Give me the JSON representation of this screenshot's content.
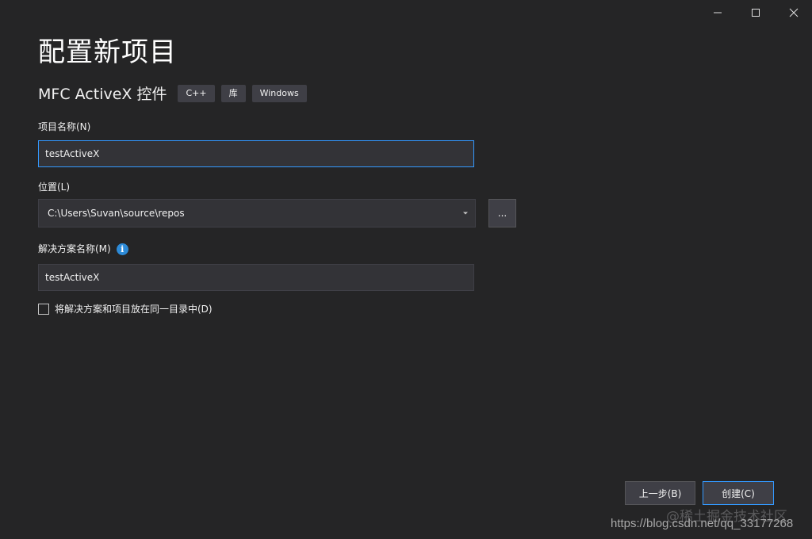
{
  "window_controls": {
    "minimize": "minimize-icon",
    "maximize": "maximize-icon",
    "close": "close-icon"
  },
  "header": {
    "title": "配置新项目",
    "template_name": "MFC ActiveX 控件",
    "tags": [
      "C++",
      "库",
      "Windows"
    ]
  },
  "form": {
    "project_name": {
      "label": "项目名称(N)",
      "value": "testActiveX"
    },
    "location": {
      "label": "位置(L)",
      "value": "C:\\Users\\Suvan\\source\\repos",
      "browse_label": "..."
    },
    "solution_name": {
      "label": "解决方案名称(M)",
      "info_icon": "i",
      "value": "testActiveX"
    },
    "same_dir_checkbox": {
      "label": "将解决方案和项目放在同一目录中(D)",
      "checked": false
    }
  },
  "footer": {
    "back_label": "上一步(B)",
    "create_label": "创建(C)"
  },
  "watermark": {
    "site": "@稀土掘金技术社区",
    "url": "https://blog.csdn.net/qq_33177268"
  },
  "colors": {
    "background": "#252526",
    "input_bg": "#333337",
    "focus_border": "#3399ff",
    "info_blue": "#2d8bd8"
  }
}
